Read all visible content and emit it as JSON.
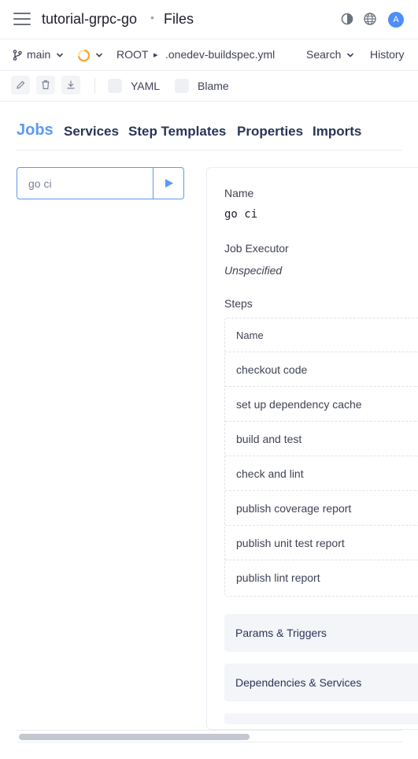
{
  "header": {
    "project": "tutorial-grpc-go",
    "separator": "•",
    "section": "Files",
    "avatar_letter": "A",
    "icons": [
      "menu-icon",
      "theme-toggle-icon",
      "language-globe-icon"
    ]
  },
  "branchbar": {
    "branch": "main",
    "path_root": "ROOT",
    "path_separator": "▸",
    "file": ".onedev-buildspec.yml",
    "search_label": "Search",
    "history_label": "History"
  },
  "toolbar": {
    "yaml_label": "YAML",
    "blame_label": "Blame"
  },
  "tabs": [
    "Jobs",
    "Services",
    "Step Templates",
    "Properties",
    "Imports"
  ],
  "job_selector": {
    "value": "go ci"
  },
  "job": {
    "name_label": "Name",
    "name_value": "go ci",
    "executor_label": "Job Executor",
    "executor_value": "Unspecified",
    "steps_label": "Steps",
    "steps_header": "Name",
    "steps": [
      "checkout code",
      "set up dependency cache",
      "build and test",
      "check and lint",
      "publish coverage report",
      "publish unit test report",
      "publish lint report"
    ],
    "sections": [
      "Params & Triggers",
      "Dependencies & Services"
    ]
  },
  "colors": {
    "accent": "#5b9bf2",
    "avatar": "#4f8ef7",
    "heading": "#2a3556"
  }
}
